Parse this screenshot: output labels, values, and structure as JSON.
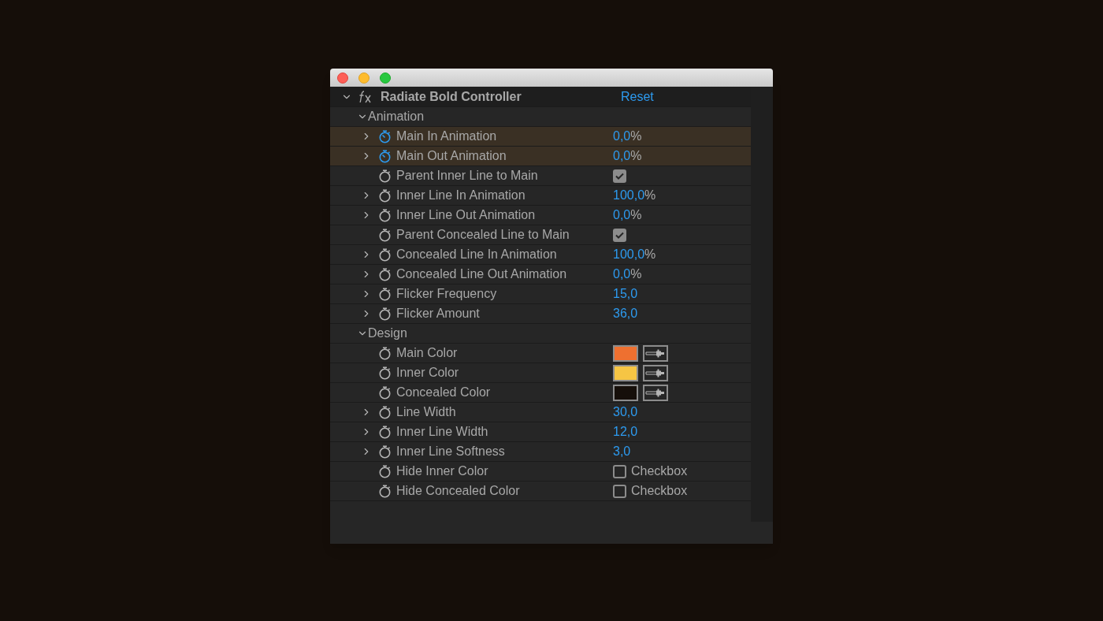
{
  "effect": {
    "name": "Radiate Bold Controller",
    "expanded": true,
    "reset": "Reset"
  },
  "groups": [
    {
      "label": "Animation",
      "expanded": true,
      "params": [
        {
          "name": "Main In Animation",
          "expandable": true,
          "stopwatch_on": true,
          "selected": true,
          "kind": "value",
          "value": "0,0",
          "unit": "%"
        },
        {
          "name": "Main Out Animation",
          "expandable": true,
          "stopwatch_on": true,
          "selected": true,
          "kind": "value",
          "value": "0,0",
          "unit": "%"
        },
        {
          "name": "Parent Inner Line to Main",
          "expandable": false,
          "stopwatch_on": false,
          "selected": false,
          "kind": "checkbox",
          "checked": true
        },
        {
          "name": "Inner Line In Animation",
          "expandable": true,
          "stopwatch_on": false,
          "selected": false,
          "kind": "value",
          "value": "100,0",
          "unit": "%"
        },
        {
          "name": "Inner Line Out Animation",
          "expandable": true,
          "stopwatch_on": false,
          "selected": false,
          "kind": "value",
          "value": "0,0",
          "unit": "%"
        },
        {
          "name": "Parent Concealed Line to Main",
          "expandable": false,
          "stopwatch_on": false,
          "selected": false,
          "kind": "checkbox",
          "checked": true
        },
        {
          "name": "Concealed Line In Animation",
          "expandable": true,
          "stopwatch_on": false,
          "selected": false,
          "kind": "value",
          "value": "100,0",
          "unit": "%"
        },
        {
          "name": "Concealed Line Out Animation",
          "expandable": true,
          "stopwatch_on": false,
          "selected": false,
          "kind": "value",
          "value": "0,0",
          "unit": "%"
        },
        {
          "name": "Flicker Frequency",
          "expandable": true,
          "stopwatch_on": false,
          "selected": false,
          "kind": "value",
          "value": "15,0"
        },
        {
          "name": "Flicker Amount",
          "expandable": true,
          "stopwatch_on": false,
          "selected": false,
          "kind": "value",
          "value": "36,0"
        }
      ]
    },
    {
      "label": "Design",
      "expanded": true,
      "params": [
        {
          "name": "Main Color",
          "expandable": false,
          "stopwatch_on": false,
          "selected": false,
          "kind": "color",
          "color": "#ee7030"
        },
        {
          "name": "Inner Color",
          "expandable": false,
          "stopwatch_on": false,
          "selected": false,
          "kind": "color",
          "color": "#f6c544"
        },
        {
          "name": "Concealed Color",
          "expandable": false,
          "stopwatch_on": false,
          "selected": false,
          "kind": "color",
          "color": "#160f0a"
        },
        {
          "name": "Line Width",
          "expandable": true,
          "stopwatch_on": false,
          "selected": false,
          "kind": "value",
          "value": "30,0"
        },
        {
          "name": "Inner Line Width",
          "expandable": true,
          "stopwatch_on": false,
          "selected": false,
          "kind": "value",
          "value": "12,0"
        },
        {
          "name": "Inner Line Softness",
          "expandable": true,
          "stopwatch_on": false,
          "selected": false,
          "kind": "value",
          "value": "3,0"
        },
        {
          "name": "Hide Inner Color",
          "expandable": false,
          "stopwatch_on": false,
          "selected": false,
          "kind": "checkbox",
          "checked": false,
          "label": "Checkbox"
        },
        {
          "name": "Hide Concealed Color",
          "expandable": false,
          "stopwatch_on": false,
          "selected": false,
          "kind": "checkbox",
          "checked": false,
          "label": "Checkbox"
        }
      ]
    }
  ]
}
